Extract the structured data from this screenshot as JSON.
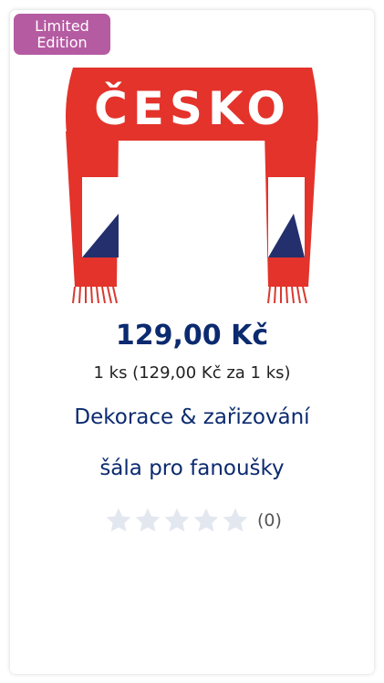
{
  "badge": {
    "line1": "Limited",
    "line2": "Edition"
  },
  "product": {
    "image_text": "ČESKO",
    "price": "129,00 Kč",
    "unit_price": "1 ks (129,00 Kč za 1 ks)",
    "category": "Dekorace & zařizování",
    "name": "šála pro fanoušky",
    "rating": {
      "stars_filled": 0,
      "stars_total": 5,
      "count": "(0)"
    }
  },
  "colors": {
    "badge": "#b55ba2",
    "price": "#0b2a6f",
    "scarf_red": "#e3332b",
    "flag_blue": "#24306e",
    "star_empty": "#e3e7ef"
  }
}
